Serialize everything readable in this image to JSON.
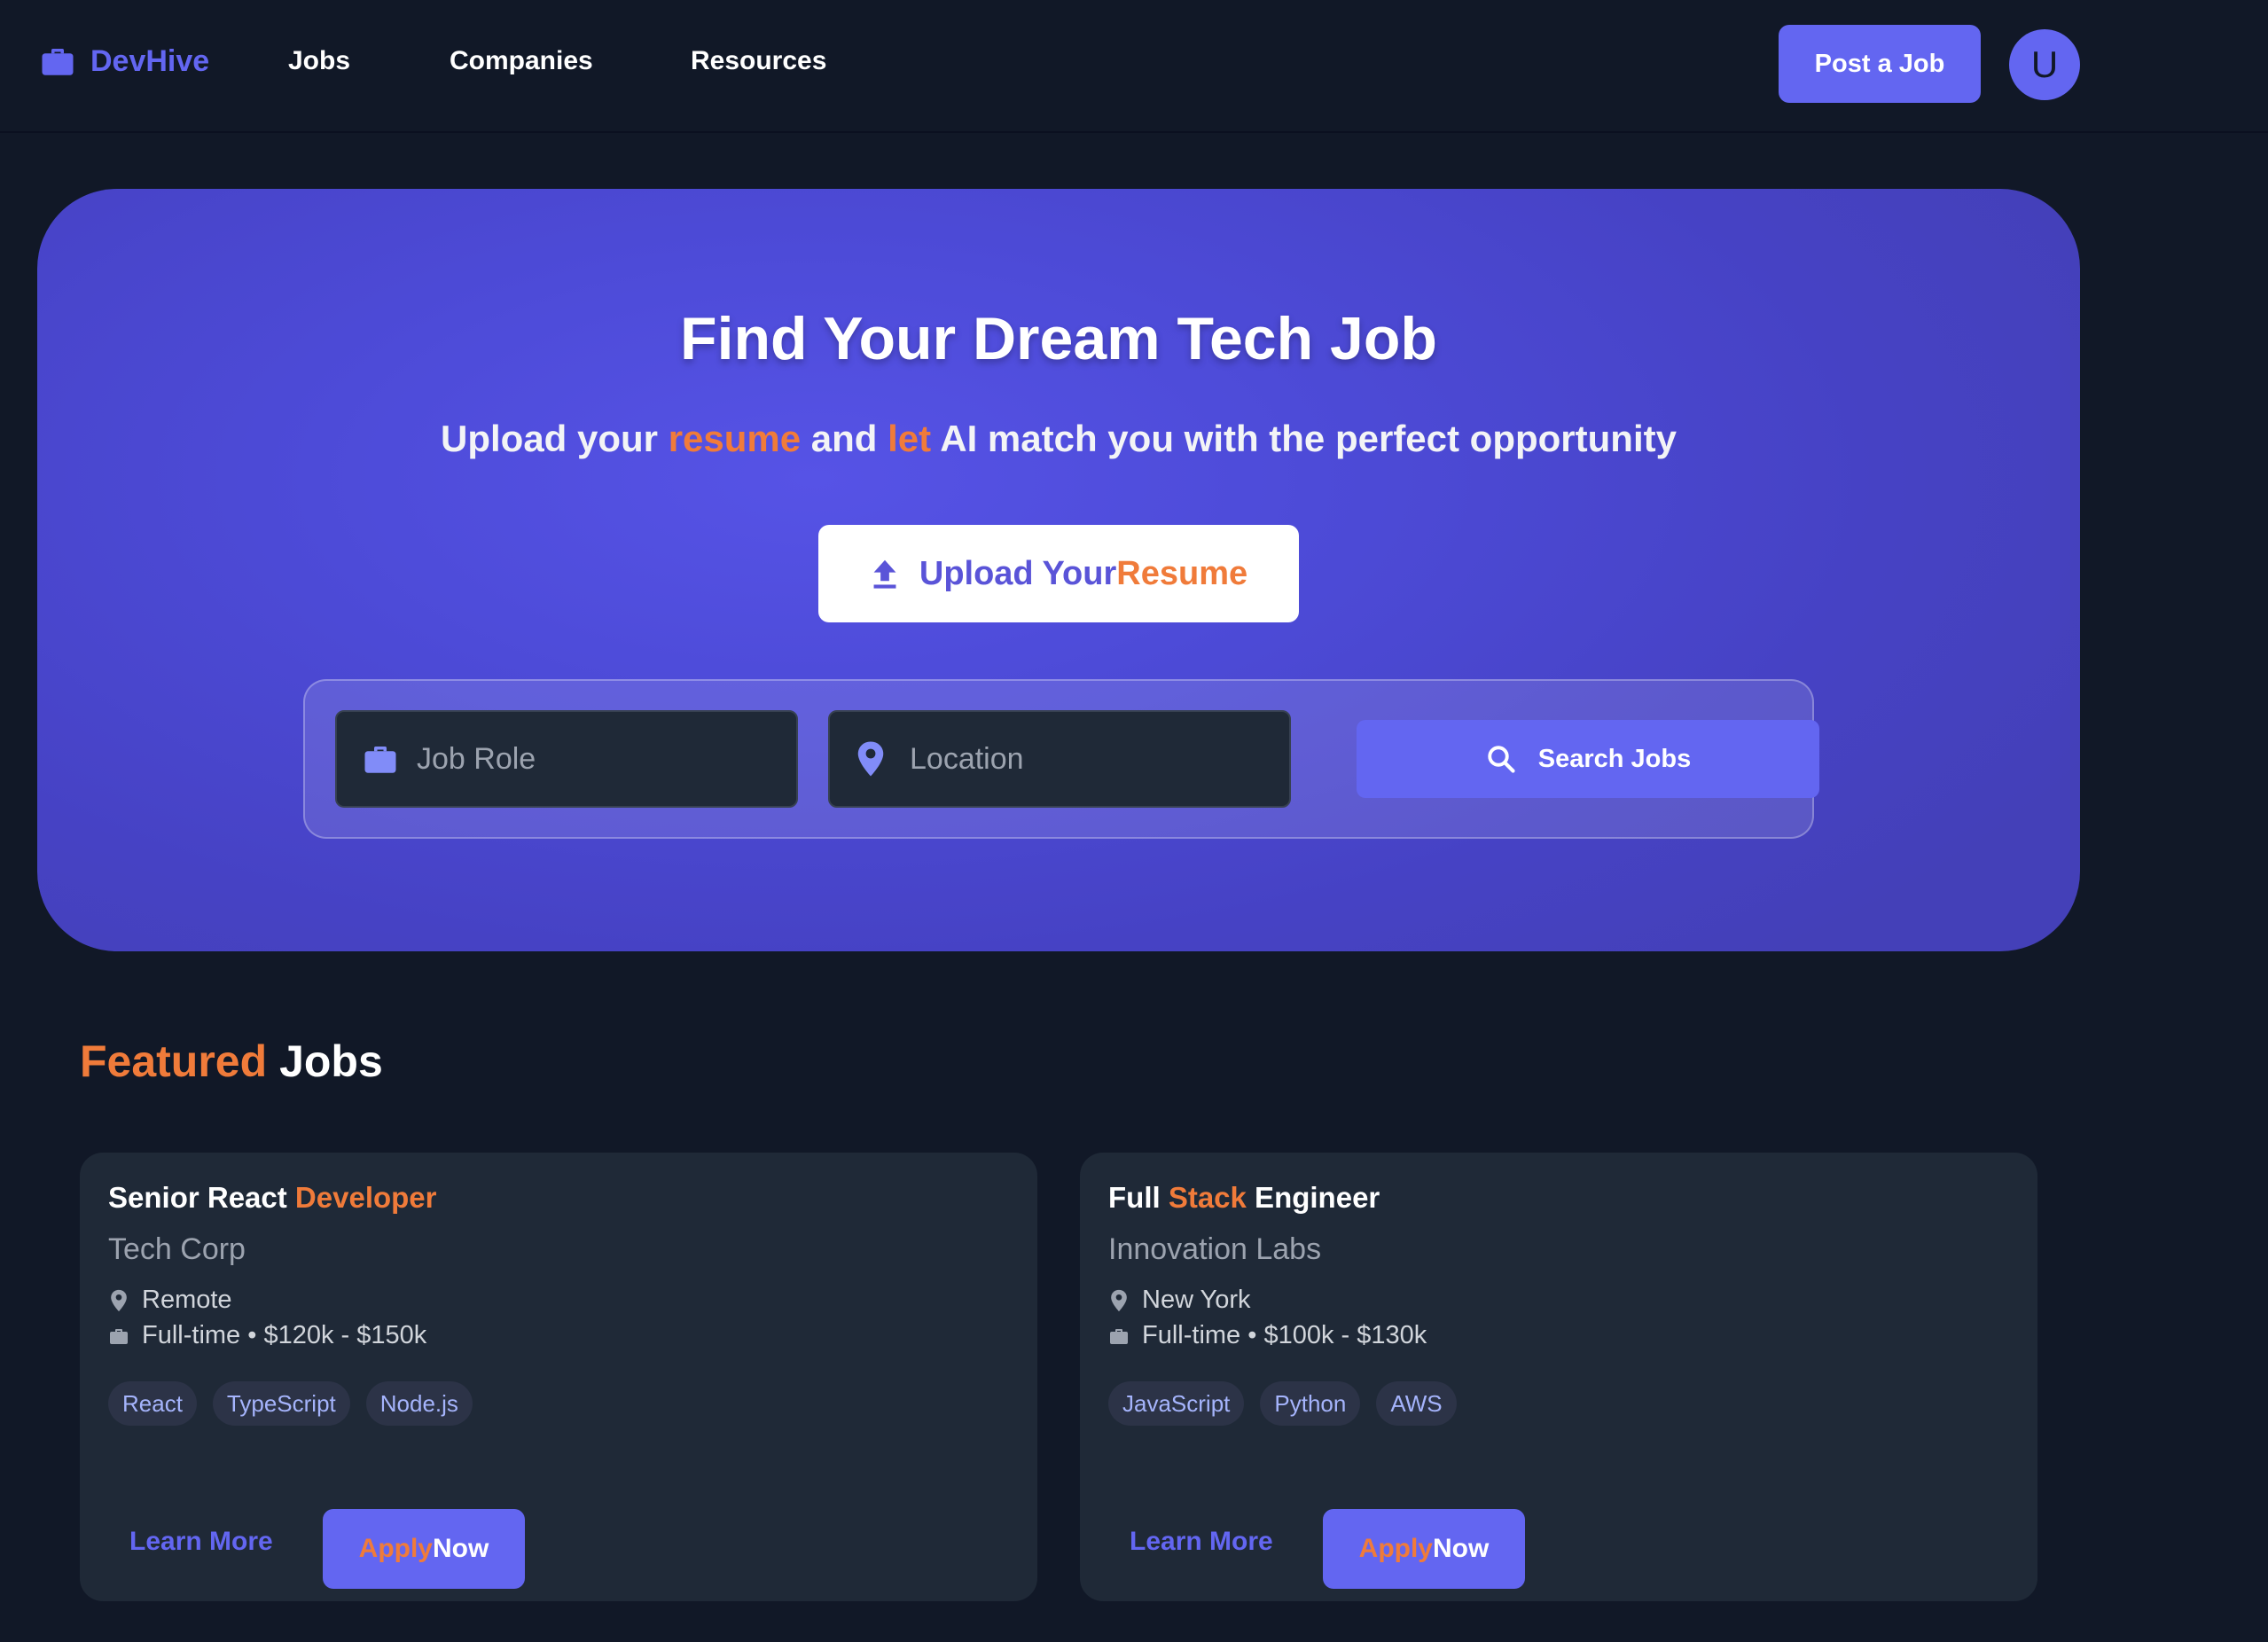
{
  "navbar": {
    "brand": "DevHive",
    "links": [
      "Jobs",
      "Companies",
      "Resources"
    ],
    "post_job": "Post a Job",
    "avatar_initial": "U"
  },
  "hero": {
    "title": "Find Your Dream Tech Job",
    "subtitle": {
      "part1": "Upload your ",
      "accent1": "resume",
      "part2": " and ",
      "accent2": "let",
      "part3": " AI match you with the perfect opportunity"
    },
    "upload": {
      "main": "Upload Your",
      "accent": "Resume"
    },
    "search": {
      "job_role_placeholder": "Job Role",
      "job_role_value": "",
      "location_placeholder": "Location",
      "location_value": "",
      "button": "Search Jobs"
    }
  },
  "featured": {
    "title_accent": "Featured",
    "title_rest": " Jobs",
    "jobs": [
      {
        "title_pre": "Senior React ",
        "title_accent": "Developer",
        "title_post": "",
        "company": "Tech Corp",
        "location": "Remote",
        "type_salary": "Full-time • $120k - $150k",
        "tags": [
          "React",
          "TypeScript",
          "Node.js"
        ],
        "learn_more": "Learn More",
        "apply_accent": "Apply",
        "apply_rest": "Now"
      },
      {
        "title_pre": "Full ",
        "title_accent": "Stack",
        "title_post": " Engineer",
        "company": "Innovation Labs",
        "location": "New York",
        "type_salary": "Full-time • $100k - $130k",
        "tags": [
          "JavaScript",
          "Python",
          "AWS"
        ],
        "learn_more": "Learn More",
        "apply_accent": "Apply",
        "apply_rest": "Now"
      }
    ]
  },
  "colors": {
    "background": "#111827",
    "primary": "#6366f1",
    "accent": "#f07b3a",
    "card": "#1f2937"
  },
  "icons": {
    "brand": "briefcase-icon",
    "upload": "upload-icon",
    "job_role": "briefcase-icon",
    "location": "map-pin-icon",
    "search": "search-icon"
  }
}
